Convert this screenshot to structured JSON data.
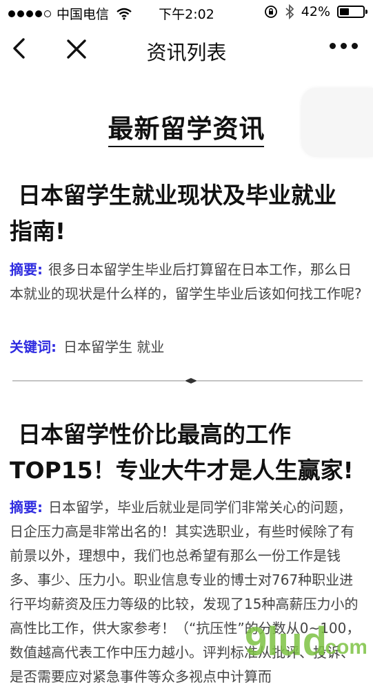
{
  "status_bar": {
    "carrier": "中国电信",
    "time": "下午2:02",
    "battery": "42%",
    "battery_level": 0.42
  },
  "nav": {
    "title": "资讯列表",
    "back_icon": "chevron-left-icon",
    "close_icon": "close-icon",
    "more_icon": "more-dots-icon"
  },
  "page": {
    "title": "最新留学资讯"
  },
  "articles": [
    {
      "title_lines": [
        "日本留学生就业现状及毕业就业",
        "指南!"
      ],
      "summary_label": "摘要:",
      "summary": "很多日本留学生毕业后打算留在日本工作，那么日本就业的现状是什么样的，留学生毕业后该如何找工作呢?",
      "keywords_label": "关键词:",
      "keywords": "日本留学生 就业"
    },
    {
      "title_lines": [
        "日本留学性价比最高的工作",
        "TOP15！专业大牛才是人生赢家!"
      ],
      "summary_label": "摘要:",
      "summary": "日本留学，毕业后就业是同学们非常关心的问题，日企压力高是非常出名的！其实选职业，有些时候除了有前景以外，理想中，我们也总希望有那么一份工作是钱多、事少、压力小。职业信息专业的博士对767种职业进行平均薪资及压力等级的比较，发现了15种高薪压力小的高性比工作，供大家参考！（“抗压性”的分数从0~100，数值越高代表工作中压力越小。评判标准从批评、投诉、是否需要应对紧急事件等众多视点中计算而"
    }
  ],
  "watermark": "9lud.com"
}
